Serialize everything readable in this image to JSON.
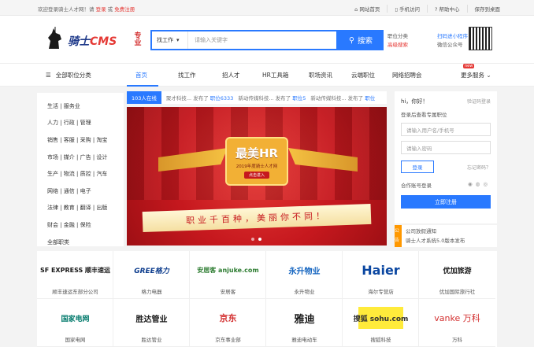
{
  "topbar": {
    "welcome_prefix": "欢迎登录骑士人才网！请",
    "login": "登录",
    "or": "或",
    "register": "免费注册",
    "links": [
      "网站首页",
      "手机访问",
      "帮助中心",
      "保存到桌面"
    ]
  },
  "header": {
    "logo_text": "骑士",
    "logo_cms": "CMS",
    "seal_text": "专业",
    "search_type": "找工作",
    "search_placeholder": "请输入关键字",
    "search_button": "搜索",
    "job_category": "职位分类",
    "advanced_search": "高级搜索",
    "miniapp": "扫码进小程序",
    "wechat": "微信公众号"
  },
  "nav": {
    "all_categories": "全部职位分类",
    "items": [
      "首页",
      "找工作",
      "招人才",
      "HR工具箱",
      "职场资讯",
      "云端职位",
      "网络招聘会"
    ],
    "more": "更多服务",
    "new_badge": "new"
  },
  "sidebar": {
    "items": [
      "生活 | 服务业",
      "人力 | 行政 | 管理",
      "销售 | 客服 | 采购 | 淘宝",
      "市场 | 媒介 | 广告 | 设计",
      "生产 | 物流 | 质控 | 汽车",
      "网络 | 通信 | 电子",
      "法律 | 教育 | 翻译 | 出版",
      "财会 | 金融 | 保险",
      "全部职类"
    ]
  },
  "ticker": {
    "badge": "103人在线",
    "messages": [
      {
        "company": "聚才科技...",
        "text": "发布了",
        "job": "职位6333"
      },
      {
        "company": "新动传媒科技...",
        "text": "发布了",
        "job": "职位5"
      },
      {
        "company": "新动传媒科技...",
        "text": "发布了",
        "job": "职位"
      }
    ]
  },
  "banner": {
    "title": "最美HR",
    "subtitle": "2019年度骑士人才网",
    "button": "点击进入",
    "slogan": "职业千百种，美丽你不同！"
  },
  "login": {
    "greeting": "hi，你好！",
    "code_login": "验证码登录",
    "hint": "登录后查看专属职位",
    "username_placeholder": "请输入用户名/手机号",
    "password_placeholder": "请输入密码",
    "login_button": "登录",
    "forgot": "忘记密码？",
    "coop": "合作账号登录",
    "register_button": "立即注册"
  },
  "notice": {
    "tab": "公告",
    "lines": [
      "公司放假通知",
      "骑士人才系统5.0版本发布"
    ]
  },
  "brands": [
    {
      "logo": "SF EXPRESS 顺丰速运",
      "name": "顺丰速运东部分公司",
      "color": "#1a1a1a"
    },
    {
      "logo": "GREE格力",
      "name": "格力电器",
      "color": "#0b3b8c"
    },
    {
      "logo": "安居客 anjuke.com",
      "name": "安居客",
      "color": "#2e7d32"
    },
    {
      "logo": "永升物业",
      "name": "永升物业",
      "color": "#1565c0"
    },
    {
      "logo": "Haier",
      "name": "海尔专营店",
      "color": "#0b47a1"
    },
    {
      "logo": "优加旅游",
      "name": "优加国际旅行社",
      "color": "#1a1a1a"
    },
    {
      "logo": "国家电网",
      "name": "国家电网",
      "color": "#00796b"
    },
    {
      "logo": "胜达管业",
      "name": "胜达管业",
      "color": "#1a1a1a"
    },
    {
      "logo": "京东",
      "name": "京东事业部",
      "color": "#d32f2f"
    },
    {
      "logo": "雅迪",
      "name": "雅迪电动车",
      "color": "#1a1a1a"
    },
    {
      "logo": "搜狐 sohu.com",
      "name": "搜狐科技",
      "color": "#333"
    },
    {
      "logo": "vanke 万科",
      "name": "万科",
      "color": "#d32f2f"
    }
  ]
}
